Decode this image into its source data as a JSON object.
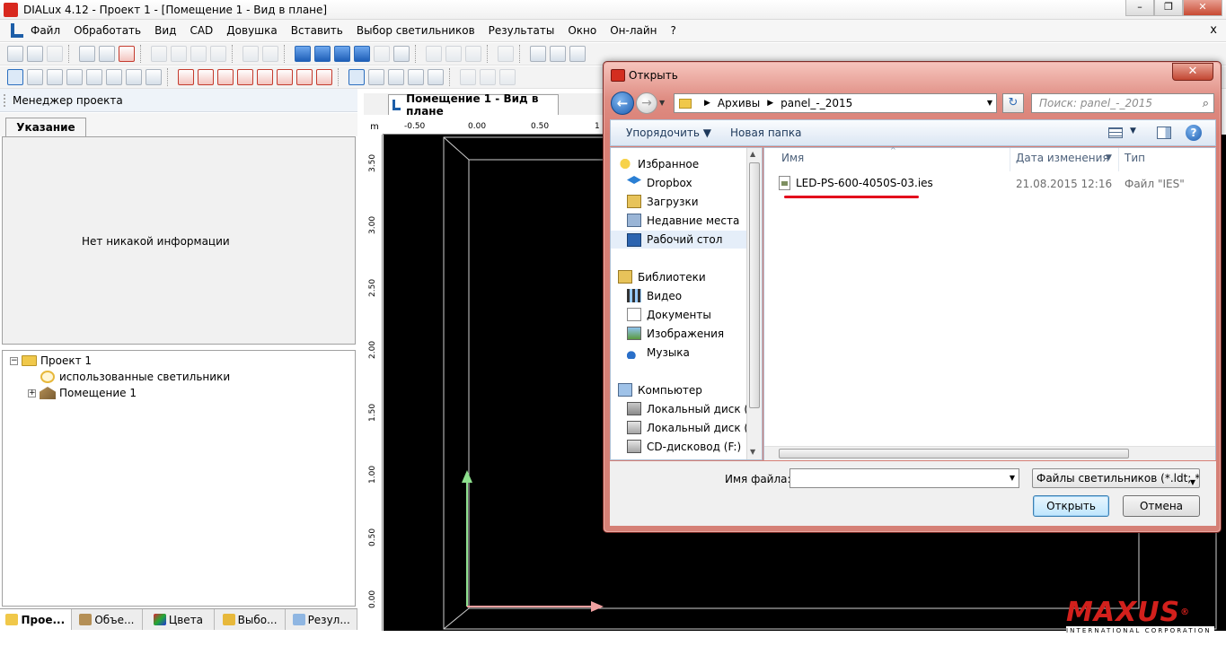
{
  "app": {
    "title": "DIALux 4.12 - Проект 1 - [Помещение 1 - Вид в плане]",
    "window_buttons": [
      "–",
      "❐",
      "✕"
    ],
    "mdi_close": "x"
  },
  "menu": {
    "items": [
      "Файл",
      "Обработать",
      "Вид",
      "CAD",
      "Довушка",
      "Вставить",
      "Выбор светильников",
      "Результаты",
      "Окно",
      "Он-лайн",
      "?"
    ]
  },
  "left_panel": {
    "header": "Менеджер проекта",
    "tab": "Указание",
    "info_text": "Нет никакой информации",
    "tree": {
      "project": "Проект 1",
      "luminaires": "использованные светильники",
      "room": "Помещение 1",
      "expander_open": "−",
      "expander_closed": "+"
    },
    "bottom_tabs": [
      "Прое...",
      "Объе...",
      "Цвета",
      "Выбо...",
      "Резул..."
    ]
  },
  "plan_view": {
    "tab": "Помещение 1 - Вид в плане",
    "ruler_unit": "m",
    "ruler_h": [
      "-0.50",
      "0.00",
      "0.50",
      "1"
    ],
    "ruler_v": [
      "3.50",
      "3.00",
      "2.50",
      "2.00",
      "1.50",
      "1.00",
      "0.50",
      "0.00"
    ]
  },
  "dialog": {
    "title": "Открыть",
    "close": "✕",
    "nav": {
      "back": "←",
      "forward": "→",
      "dropdown": "▼"
    },
    "path": [
      "Архивы",
      "panel_-_2015"
    ],
    "path_separator": "▶",
    "refresh": "↻",
    "search_placeholder": "Поиск: panel_-_2015",
    "search_icon": "⌕",
    "toolbar": {
      "organize": "Упорядочить ▼",
      "new_folder": "Новая папка",
      "views_dropdown": "▼",
      "help": "?"
    },
    "nav_pane": [
      {
        "label": "Избранное",
        "icon": "star-icon",
        "group": true
      },
      {
        "label": "Dropbox",
        "icon": "dropbox-icon"
      },
      {
        "label": "Загрузки",
        "icon": "downloads-icon"
      },
      {
        "label": "Недавние места",
        "icon": "recent-places-icon"
      },
      {
        "label": "Рабочий стол",
        "icon": "desktop-icon",
        "selected": true
      },
      {
        "label": "Библиотеки",
        "icon": "libraries-icon",
        "group": true
      },
      {
        "label": "Видео",
        "icon": "video-icon"
      },
      {
        "label": "Документы",
        "icon": "documents-icon"
      },
      {
        "label": "Изображения",
        "icon": "images-icon"
      },
      {
        "label": "Музыка",
        "icon": "music-icon"
      },
      {
        "label": "Компьютер",
        "icon": "computer-icon",
        "group": true
      },
      {
        "label": "Локальный диск (С",
        "icon": "system-disk-icon"
      },
      {
        "label": "Локальный диск (D",
        "icon": "disk-icon"
      },
      {
        "label": "CD-дисковод (F:)",
        "icon": "cd-drive-icon"
      }
    ],
    "scroll_arrows": {
      "up": "▲",
      "down": "▼"
    },
    "columns": {
      "name": "Имя",
      "date": "Дата изменения",
      "type": "Тип",
      "sort_indicator": "^",
      "filter": "▼"
    },
    "files": [
      {
        "name": "LED-PS-600-4050S-03.ies",
        "date": "21.08.2015 12:16",
        "type": "Файл \"IES\""
      }
    ],
    "filename_label": "Имя файла:",
    "filename_value": "",
    "filename_dropdown": "▼",
    "filter": "Файлы светильников (*.ldt; *.e",
    "filter_dropdown": "▼",
    "open_button": "Открыть",
    "cancel_button": "Отмена"
  },
  "watermark": {
    "logo": "MAXUS",
    "registered": "®",
    "subtitle": "INTERNATIONAL CORPORATION"
  },
  "colors": {
    "accent_red": "#d2201c",
    "axis_y": "#8ee08e",
    "axis_x": "#f0a0a0",
    "selection_blue": "#1d5ea8"
  }
}
